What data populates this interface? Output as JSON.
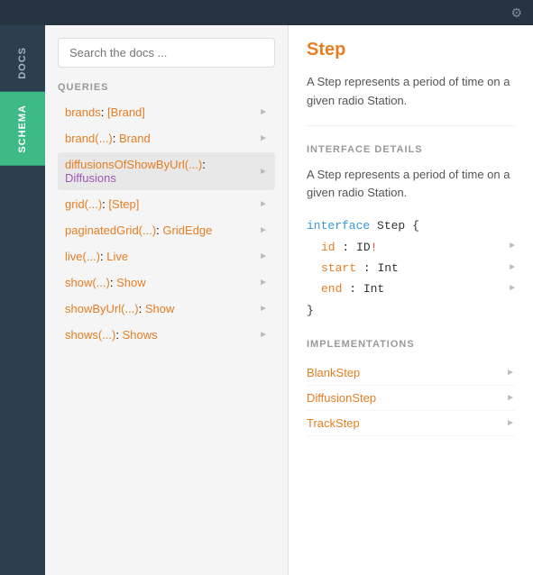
{
  "topbar": {
    "gear_icon": "⚙"
  },
  "sideTabs": [
    {
      "id": "docs",
      "label": "DOCS",
      "active": false
    },
    {
      "id": "schema",
      "label": "SCHEMA",
      "active": true
    }
  ],
  "leftPanel": {
    "search": {
      "placeholder": "Search the docs ..."
    },
    "queriesLabel": "QUERIES",
    "queries": [
      {
        "id": "brands",
        "prefix": "brands",
        "suffix": "[Brand]",
        "active": false
      },
      {
        "id": "brand",
        "prefix": "brand(...)",
        "sep": ": ",
        "suffix": "Brand",
        "active": false
      },
      {
        "id": "diffusionsOfShowByUrl",
        "prefix": "diffusionsOfShowByUrl(...)",
        "sep": ": ",
        "suffix": "Diffusions",
        "active": true,
        "suffixClass": "purple"
      },
      {
        "id": "grid",
        "prefix": "grid(...)",
        "sep": ": ",
        "suffix": "[Step]",
        "active": false
      },
      {
        "id": "paginatedGrid",
        "prefix": "paginatedGrid(...)",
        "sep": ": ",
        "suffix": "GridEdge",
        "active": false
      },
      {
        "id": "live",
        "prefix": "live(...)",
        "sep": ": ",
        "suffix": "Live",
        "active": false
      },
      {
        "id": "show",
        "prefix": "show(...)",
        "sep": ": ",
        "suffix": "Show",
        "active": false
      },
      {
        "id": "showByUrl",
        "prefix": "showByUrl(...)",
        "sep": ": ",
        "suffix": "Show",
        "active": false
      },
      {
        "id": "shows",
        "prefix": "shows(...)",
        "sep": ": ",
        "suffix": "Shows",
        "active": false
      }
    ]
  },
  "rightPanel": {
    "title": "Step",
    "description": "A Step represents a period of time on a given radio Station.",
    "interfaceDetails": {
      "heading": "INTERFACE DETAILS",
      "description": "A Step represents a period of time on a given radio Station.",
      "codeKeyword": "interface",
      "codeName": "Step",
      "codeOpen": "{",
      "fields": [
        {
          "name": "id",
          "sep": ": ",
          "type": "ID",
          "exclaim": "!"
        },
        {
          "name": "start",
          "sep": ": ",
          "type": "Int",
          "exclaim": ""
        },
        {
          "name": "end",
          "sep": ": ",
          "type": "Int",
          "exclaim": ""
        }
      ],
      "codeClose": "}"
    },
    "implementations": {
      "heading": "IMPLEMENTATIONS",
      "items": [
        {
          "name": "BlankStep"
        },
        {
          "name": "DiffusionStep"
        },
        {
          "name": "TrackStep"
        }
      ]
    }
  }
}
